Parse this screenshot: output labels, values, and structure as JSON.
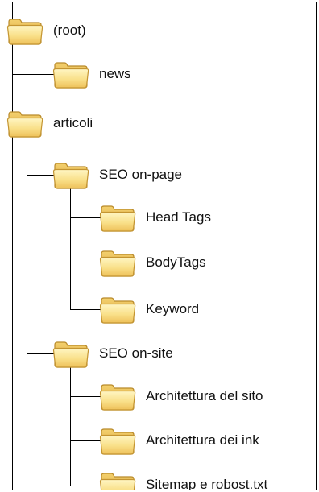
{
  "tree": {
    "root": "(root)",
    "news": "news",
    "articoli": "articoli",
    "seo_on_page": "SEO on-page",
    "head_tags": "Head Tags",
    "body_tags": "BodyTags",
    "keyword": "Keyword",
    "seo_on_site": "SEO on-site",
    "architettura_sito": "Architettura del sito",
    "architettura_ink": "Architettura dei ink",
    "sitemap": "Sitemap e robost.txt"
  },
  "icons": {
    "folder": "folder-icon"
  },
  "colors": {
    "folder_fill": "#f8dc7a",
    "folder_edge": "#c99a2e"
  }
}
